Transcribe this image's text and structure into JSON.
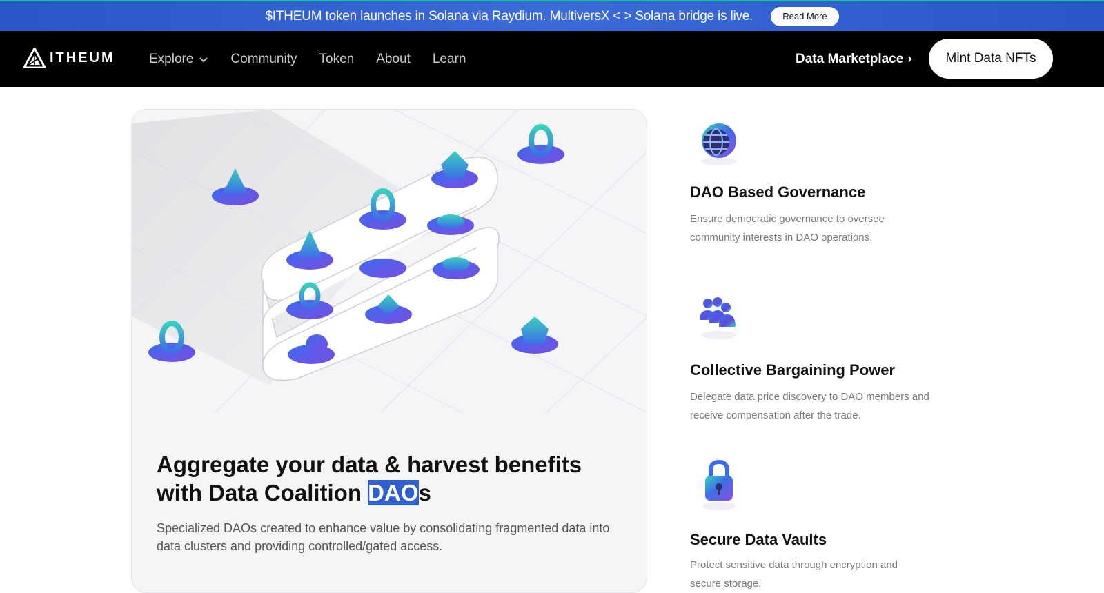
{
  "announcement": {
    "text": "$ITHEUM token launches in Solana via Raydium. MultiversX < > Solana bridge is live.",
    "button": "Read More"
  },
  "header": {
    "brand": "ITHEUM",
    "nav": [
      "Explore",
      "Community",
      "Token",
      "About",
      "Learn"
    ],
    "marketplace": "Data Marketplace",
    "marketplace_chevron": "›",
    "cta": "Mint Data NFTs"
  },
  "card": {
    "title_before": "Aggregate your data & harvest benefits with Data Coalition ",
    "title_highlight": "DAO",
    "title_after": "s",
    "description": "Specialized DAOs created to enhance value by consolidating fragmented data into data clusters and providing controlled/gated access."
  },
  "features": [
    {
      "icon": "globe-icon",
      "title": "DAO Based Governance",
      "description": "Ensure democratic governance to oversee community interests in DAO operations."
    },
    {
      "icon": "group-icon",
      "title": "Collective Bargaining Power",
      "description": "Delegate data price discovery to DAO members and receive compensation after the trade."
    },
    {
      "icon": "lock-icon",
      "title": "Secure Data Vaults",
      "description": "Protect sensitive data through encryption and secure storage."
    }
  ],
  "colors": {
    "announcement_bg": "#2a56c6",
    "highlight": "#2f5fd0",
    "accent_gradient": [
      "#3b6bf0",
      "#2ed3b7"
    ]
  }
}
